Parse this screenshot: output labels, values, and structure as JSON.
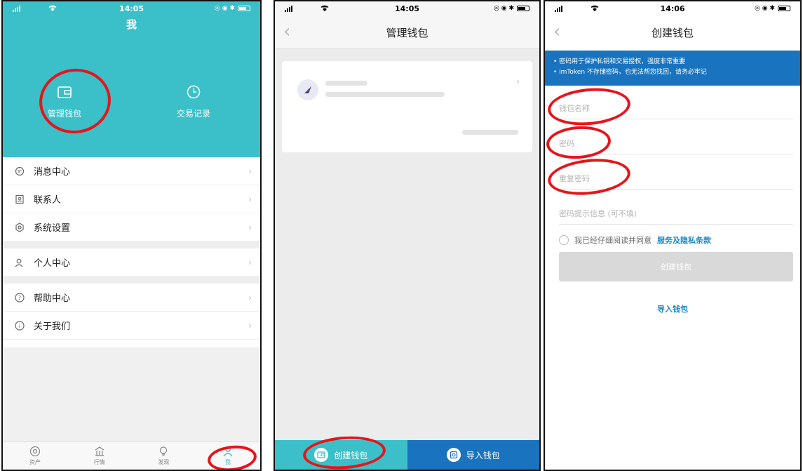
{
  "screen1": {
    "status": {
      "time": "14:05"
    },
    "title": "我",
    "header_buttons": [
      {
        "label": "管理钱包",
        "icon": "wallet-icon"
      },
      {
        "label": "交易记录",
        "icon": "clock-icon"
      }
    ],
    "menu": [
      {
        "label": "消息中心",
        "icon": "message-icon"
      },
      {
        "label": "联系人",
        "icon": "contacts-icon"
      },
      {
        "label": "系统设置",
        "icon": "gear-icon"
      },
      {
        "label": "个人中心",
        "icon": "user-icon"
      },
      {
        "label": "帮助中心",
        "icon": "help-icon"
      },
      {
        "label": "关于我们",
        "icon": "info-icon"
      }
    ],
    "tabs": [
      {
        "label": "资产",
        "icon": "assets-icon"
      },
      {
        "label": "行情",
        "icon": "market-icon"
      },
      {
        "label": "发现",
        "icon": "discover-icon"
      },
      {
        "label": "我",
        "icon": "user-icon"
      }
    ]
  },
  "screen2": {
    "status": {
      "time": "14:05"
    },
    "title": "管理钱包",
    "create_label": "创建钱包",
    "import_label": "导入钱包"
  },
  "screen3": {
    "status": {
      "time": "14:06"
    },
    "title": "创建钱包",
    "notice": [
      "• 密码用于保护私钥和交易授权，强度非常重要",
      "• imToken 不存储密码，也无法帮您找回，请务必牢记"
    ],
    "fields": [
      {
        "placeholder": "钱包名称"
      },
      {
        "placeholder": "密码"
      },
      {
        "placeholder": "重复密码"
      },
      {
        "placeholder": "密码提示信息 (可不填)"
      }
    ],
    "agree_text": "我已经仔细阅读并同意",
    "agree_link": "服务及隐私条款",
    "create_button": "创建钱包",
    "import_link": "导入钱包"
  },
  "colors": {
    "teal": "#3bbfc8",
    "blue": "#1a73bf",
    "annotation": "#e8141a"
  }
}
